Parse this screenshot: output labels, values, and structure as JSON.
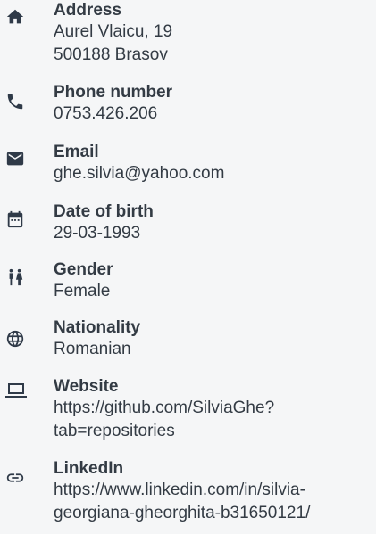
{
  "contact": {
    "address": {
      "label": "Address",
      "line1": "Aurel Vlaicu, 19",
      "line2": "500188 Brasov",
      "icon": "home-icon"
    },
    "phone": {
      "label": "Phone number",
      "value": "0753.426.206",
      "icon": "phone-icon"
    },
    "email": {
      "label": "Email",
      "value": "ghe.silvia@yahoo.com",
      "icon": "mail-icon"
    },
    "dob": {
      "label": "Date of birth",
      "value": "29-03-1993",
      "icon": "calendar-icon"
    },
    "gender": {
      "label": "Gender",
      "value": "Female",
      "icon": "people-icon"
    },
    "nationality": {
      "label": "Nationality",
      "value": "Romanian",
      "icon": "globe-icon"
    },
    "website": {
      "label": "Website",
      "line1": "https://github.com/SilviaGhe?",
      "line2": "tab=repositories",
      "icon": "laptop-icon"
    },
    "linkedin": {
      "label": "LinkedIn",
      "line1": "https://www.linkedin.com/in/silvia-",
      "line2": "georgiana-gheorghita-b31650121/",
      "icon": "link-icon"
    }
  },
  "colors": {
    "background": "#f5f6f7",
    "text": "#333b44",
    "icon": "#2f3a48"
  }
}
